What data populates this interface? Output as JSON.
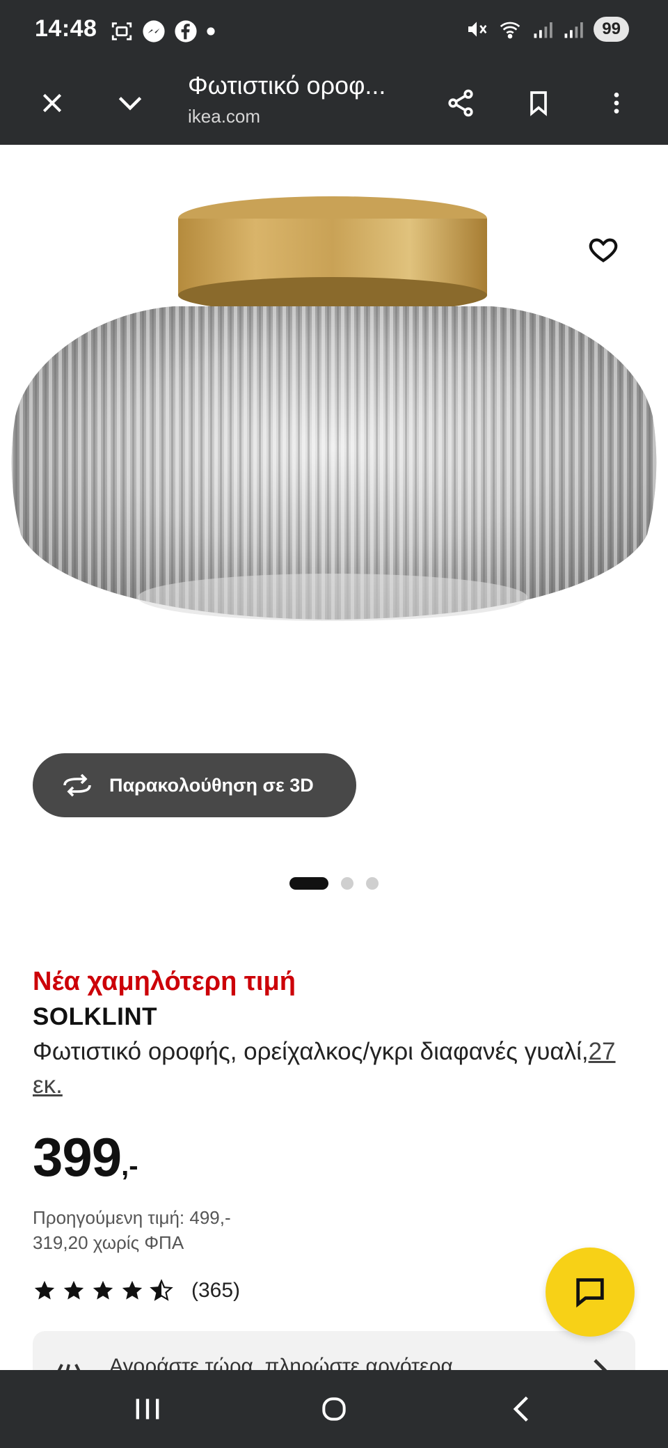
{
  "status_bar": {
    "time": "14:48",
    "battery": "99",
    "icons_left": [
      "screenshot-icon",
      "messenger-icon",
      "facebook-icon",
      "dot-icon"
    ],
    "icons_right": [
      "mute-icon",
      "wifi-icon",
      "signal-icon",
      "signal-roaming-icon"
    ]
  },
  "browser": {
    "title": "Φωτιστικό οροφ...",
    "domain": "ikea.com",
    "icons": [
      "close-icon",
      "chevron-down-icon",
      "share-icon",
      "bookmark-icon",
      "more-vert-icon"
    ]
  },
  "hero": {
    "view3d_label": "Παρακολούθηση σε 3D",
    "carousel_count": 3,
    "carousel_active": 0
  },
  "product": {
    "tag": "Νέα χαμηλότερη τιμή",
    "name": "SOLKLINT",
    "desc": "Φωτιστικό οροφής, ορείχαλκος/γκρι διαφανές γυαλί,",
    "size": "27 εκ.",
    "price": "399",
    "price_suffix": ",-",
    "previous_price": "Προηγούμενη τιμή: 499,-",
    "price_no_vat": "319,20 χωρίς ΦΠΑ",
    "rating": 4.5,
    "rating_count": "(365)"
  },
  "bottom_card": {
    "text": "Αγοράστε τώρα, πληρώστε αργότερα"
  },
  "colors": {
    "chrome": "#2b2d2f",
    "tag_red": "#cc0008",
    "fab_yellow": "#f7d117",
    "pill_gray": "#484848"
  }
}
